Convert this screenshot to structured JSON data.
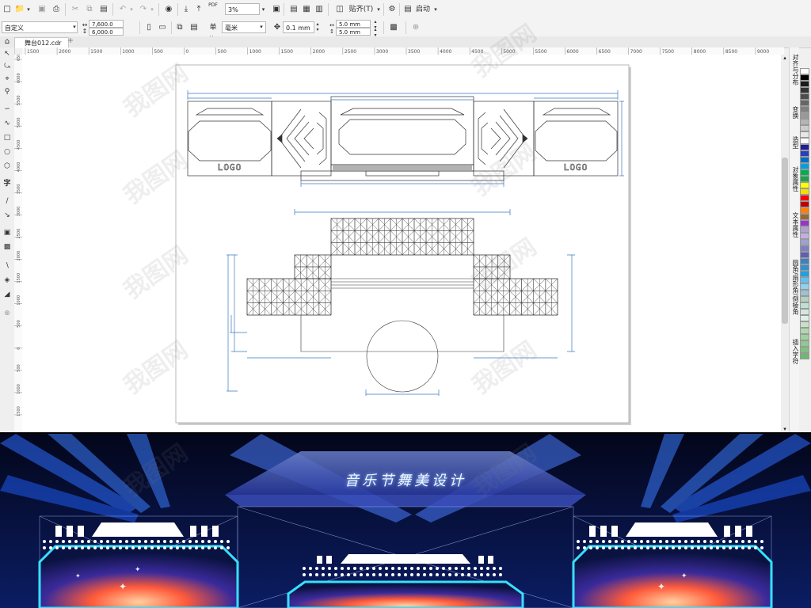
{
  "toolbar": {
    "zoom_value": "3%",
    "snap_label": "贴齐(T)",
    "launch_label": "启动",
    "pdf_label": "PDF"
  },
  "propertybar": {
    "preset_value": "自定义",
    "width_value": "7,600.0 mm",
    "height_value": "6,000.0 mm",
    "units_label": "单位:",
    "units_value": "毫米",
    "nudge_value": "0.1 mm",
    "dup_x_value": "5.0 mm",
    "dup_y_value": "5.0 mm"
  },
  "document": {
    "tab_label": "舞台012.cdr"
  },
  "ruler": {
    "h_ticks": [
      "1500",
      "2000",
      "1500",
      "1000",
      "500",
      "0",
      "500",
      "1000",
      "1500",
      "2000",
      "2500",
      "3000",
      "3500",
      "4000",
      "4500",
      "5000",
      "5500",
      "6000",
      "6500",
      "7000",
      "7500",
      "8000",
      "8500",
      "9000"
    ],
    "v_ticks": [
      "6500",
      "6000",
      "5500",
      "5000",
      "4500",
      "4000",
      "3500",
      "3000",
      "2500",
      "2000",
      "1500",
      "1000",
      "500",
      "0",
      "500",
      "1000",
      "1500"
    ]
  },
  "dock": {
    "tabs": [
      "对齐与分布",
      "变换",
      "造型",
      "对象属性",
      "文本属性",
      "圆角/扇形角/倒棱角",
      "插入字符"
    ]
  },
  "drawing": {
    "logo_left": "LOGO",
    "logo_right": "LOGO"
  },
  "photo": {
    "title": "音乐节舞美设计"
  },
  "watermark": {
    "text": "我图网"
  },
  "palette": [
    "#ffffff",
    "#000000",
    "#1a1a1a",
    "#333333",
    "#4d4d4d",
    "#666666",
    "#808080",
    "#999999",
    "#b3b3b3",
    "#cccccc",
    "#e6e6e6",
    "#ffffff",
    "#1f1f8f",
    "#2a3fbf",
    "#0070c0",
    "#00a0e0",
    "#00b050",
    "#1aa34a",
    "#ffff00",
    "#f0e000",
    "#ff0000",
    "#c00000",
    "#ff8000",
    "#996633",
    "#9933cc",
    "#b0a0d0",
    "#c0b0e0",
    "#a0a0d0",
    "#8080c0",
    "#6060b0",
    "#4080c0",
    "#3090d0",
    "#20a0e0",
    "#60c0f0",
    "#90d0f0",
    "#a0c0d0",
    "#b0d0c0",
    "#c0e0d0",
    "#d0e8e0",
    "#e0f0e8",
    "#c8e0c8",
    "#b0d8b0",
    "#a0d0a0",
    "#90c890",
    "#80c080",
    "#70b870"
  ]
}
